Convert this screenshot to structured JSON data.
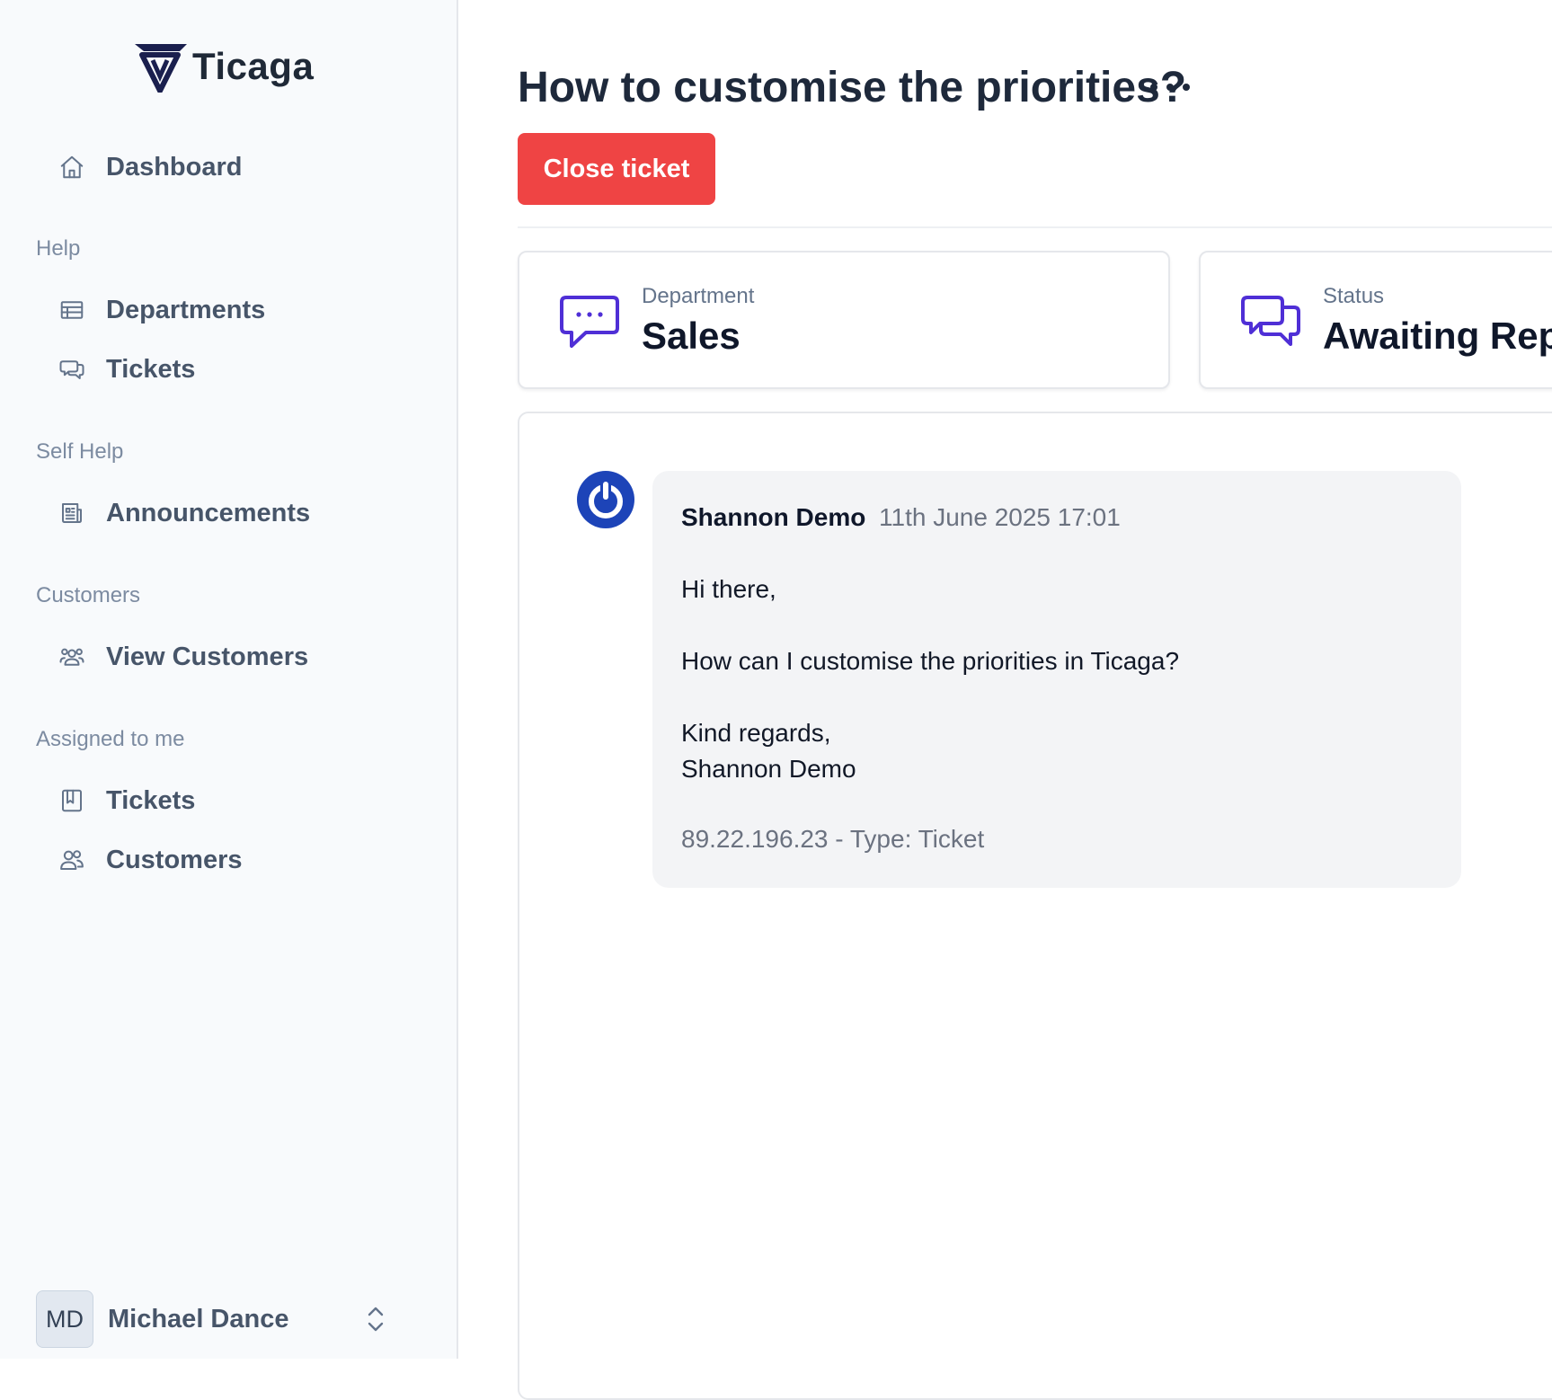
{
  "app": {
    "brand": "Ticaga",
    "brand_color": "#1a1f4e",
    "accent": "#4f2fd6",
    "danger": "#ef4444"
  },
  "sidebar": {
    "dashboard": {
      "label": "Dashboard",
      "icon": "home-icon"
    },
    "sections": [
      {
        "heading": "Help",
        "items": [
          {
            "label": "Departments",
            "icon": "table-icon"
          },
          {
            "label": "Tickets",
            "icon": "chat-bubbles-icon"
          }
        ]
      },
      {
        "heading": "Self Help",
        "items": [
          {
            "label": "Announcements",
            "icon": "newspaper-icon"
          }
        ]
      },
      {
        "heading": "Customers",
        "items": [
          {
            "label": "View Customers",
            "icon": "user-group-icon"
          }
        ]
      },
      {
        "heading": "Assigned to me",
        "items": [
          {
            "label": "Tickets",
            "icon": "book-icon"
          },
          {
            "label": "Customers",
            "icon": "users-icon"
          }
        ]
      }
    ],
    "user": {
      "initials": "MD",
      "name": "Michael Dance"
    }
  },
  "ticket": {
    "title": "How to customise the priorities?",
    "close_label": "Close ticket",
    "cards": [
      {
        "label": "Department",
        "value": "Sales",
        "icon": "chat-dots-icon"
      },
      {
        "label": "Status",
        "value": "Awaiting Rep",
        "icon": "chat-bubbles-icon"
      }
    ],
    "message": {
      "author": "Shannon Demo",
      "time": "11th June 2025 17:01",
      "lines": [
        "Hi there,",
        "How can I customise the priorities in Ticaga?",
        "Kind regards,",
        "Shannon Demo"
      ],
      "meta": "89.22.196.23 - Type: Ticket"
    }
  }
}
